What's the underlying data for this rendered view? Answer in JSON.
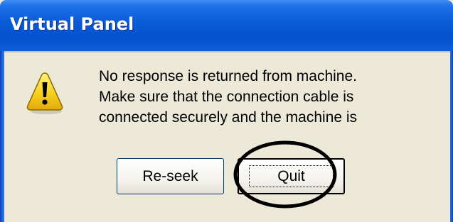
{
  "window": {
    "title": "Virtual Panel"
  },
  "dialog": {
    "icon": "warning-icon",
    "message_lines": [
      "No response is returned from machine.",
      "Make sure that the connection cable is",
      "connected securely and the machine is"
    ]
  },
  "buttons": {
    "reseek_label": "Re-seek",
    "quit_label": "Quit"
  },
  "colors": {
    "titlebar": "#0a5ad8",
    "dialog_background": "#ece9d8",
    "warning_yellow": "#f7d21e",
    "highlight_ellipse": "#000000"
  }
}
